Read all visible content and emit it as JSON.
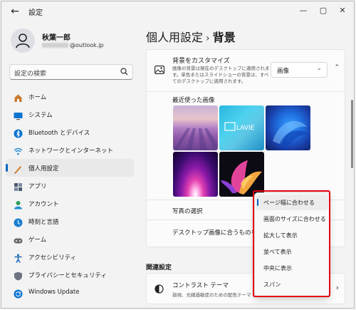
{
  "window": {
    "title": "設定",
    "controls": {
      "minimize": "—",
      "maximize": "▢",
      "close": "✕"
    }
  },
  "profile": {
    "name": "秋葉一郎",
    "email_suffix": "@outlook.jp"
  },
  "search": {
    "placeholder": "設定の検索"
  },
  "nav": [
    {
      "label": "ホーム",
      "icon": "home-icon",
      "color": "#c87a2d"
    },
    {
      "label": "システム",
      "icon": "system-icon",
      "color": "#0a74d0"
    },
    {
      "label": "Bluetooth とデバイス",
      "icon": "bluetooth-icon",
      "color": "#0a74d0"
    },
    {
      "label": "ネットワークとインターネット",
      "icon": "network-icon",
      "color": "#2a8fd6"
    },
    {
      "label": "個人用設定",
      "icon": "personalize-icon",
      "color": "#d07a2a",
      "active": true
    },
    {
      "label": "アプリ",
      "icon": "apps-icon",
      "color": "#4a5a70"
    },
    {
      "label": "アカウント",
      "icon": "account-icon",
      "color": "#2ea05a"
    },
    {
      "label": "時刻と言語",
      "icon": "time-language-icon",
      "color": "#1c7fd1"
    },
    {
      "label": "ゲーム",
      "icon": "gaming-icon",
      "color": "#6a6a6a"
    },
    {
      "label": "アクセシビリティ",
      "icon": "accessibility-icon",
      "color": "#1566b8"
    },
    {
      "label": "プライバシーとセキュリティ",
      "icon": "privacy-icon",
      "color": "#6b7380"
    },
    {
      "label": "Windows Update",
      "icon": "update-icon",
      "color": "#0a74d0"
    }
  ],
  "breadcrumb": {
    "parent": "個人用設定",
    "separator": "›",
    "current": "背景"
  },
  "background_card": {
    "title": "背景をカスタマイズ",
    "description": "画像の背景は現在のデスクトップに適用されます。単色またはスライドショーの背景は、すべてのデスクトップに適用されます。",
    "select_value": "画像"
  },
  "recent": {
    "title": "最近使った画像"
  },
  "rows": {
    "choose_photo": "写真の選択",
    "fit": "デスクトップ画像に合うものを選択"
  },
  "related": {
    "heading": "関連設定"
  },
  "contrast": {
    "title": "コントラスト テーマ",
    "description": "弱視、光線過敏症のための配色テーマ"
  },
  "fit_options": [
    {
      "label": "ページ幅に合わせる",
      "selected": true
    },
    {
      "label": "画面のサイズに合わせる"
    },
    {
      "label": "拡大して表示"
    },
    {
      "label": "並べて表示"
    },
    {
      "label": "中央に表示"
    },
    {
      "label": "スパン"
    }
  ],
  "colors": {
    "accent": "#0067c0",
    "highlight_box": "#e30012"
  }
}
